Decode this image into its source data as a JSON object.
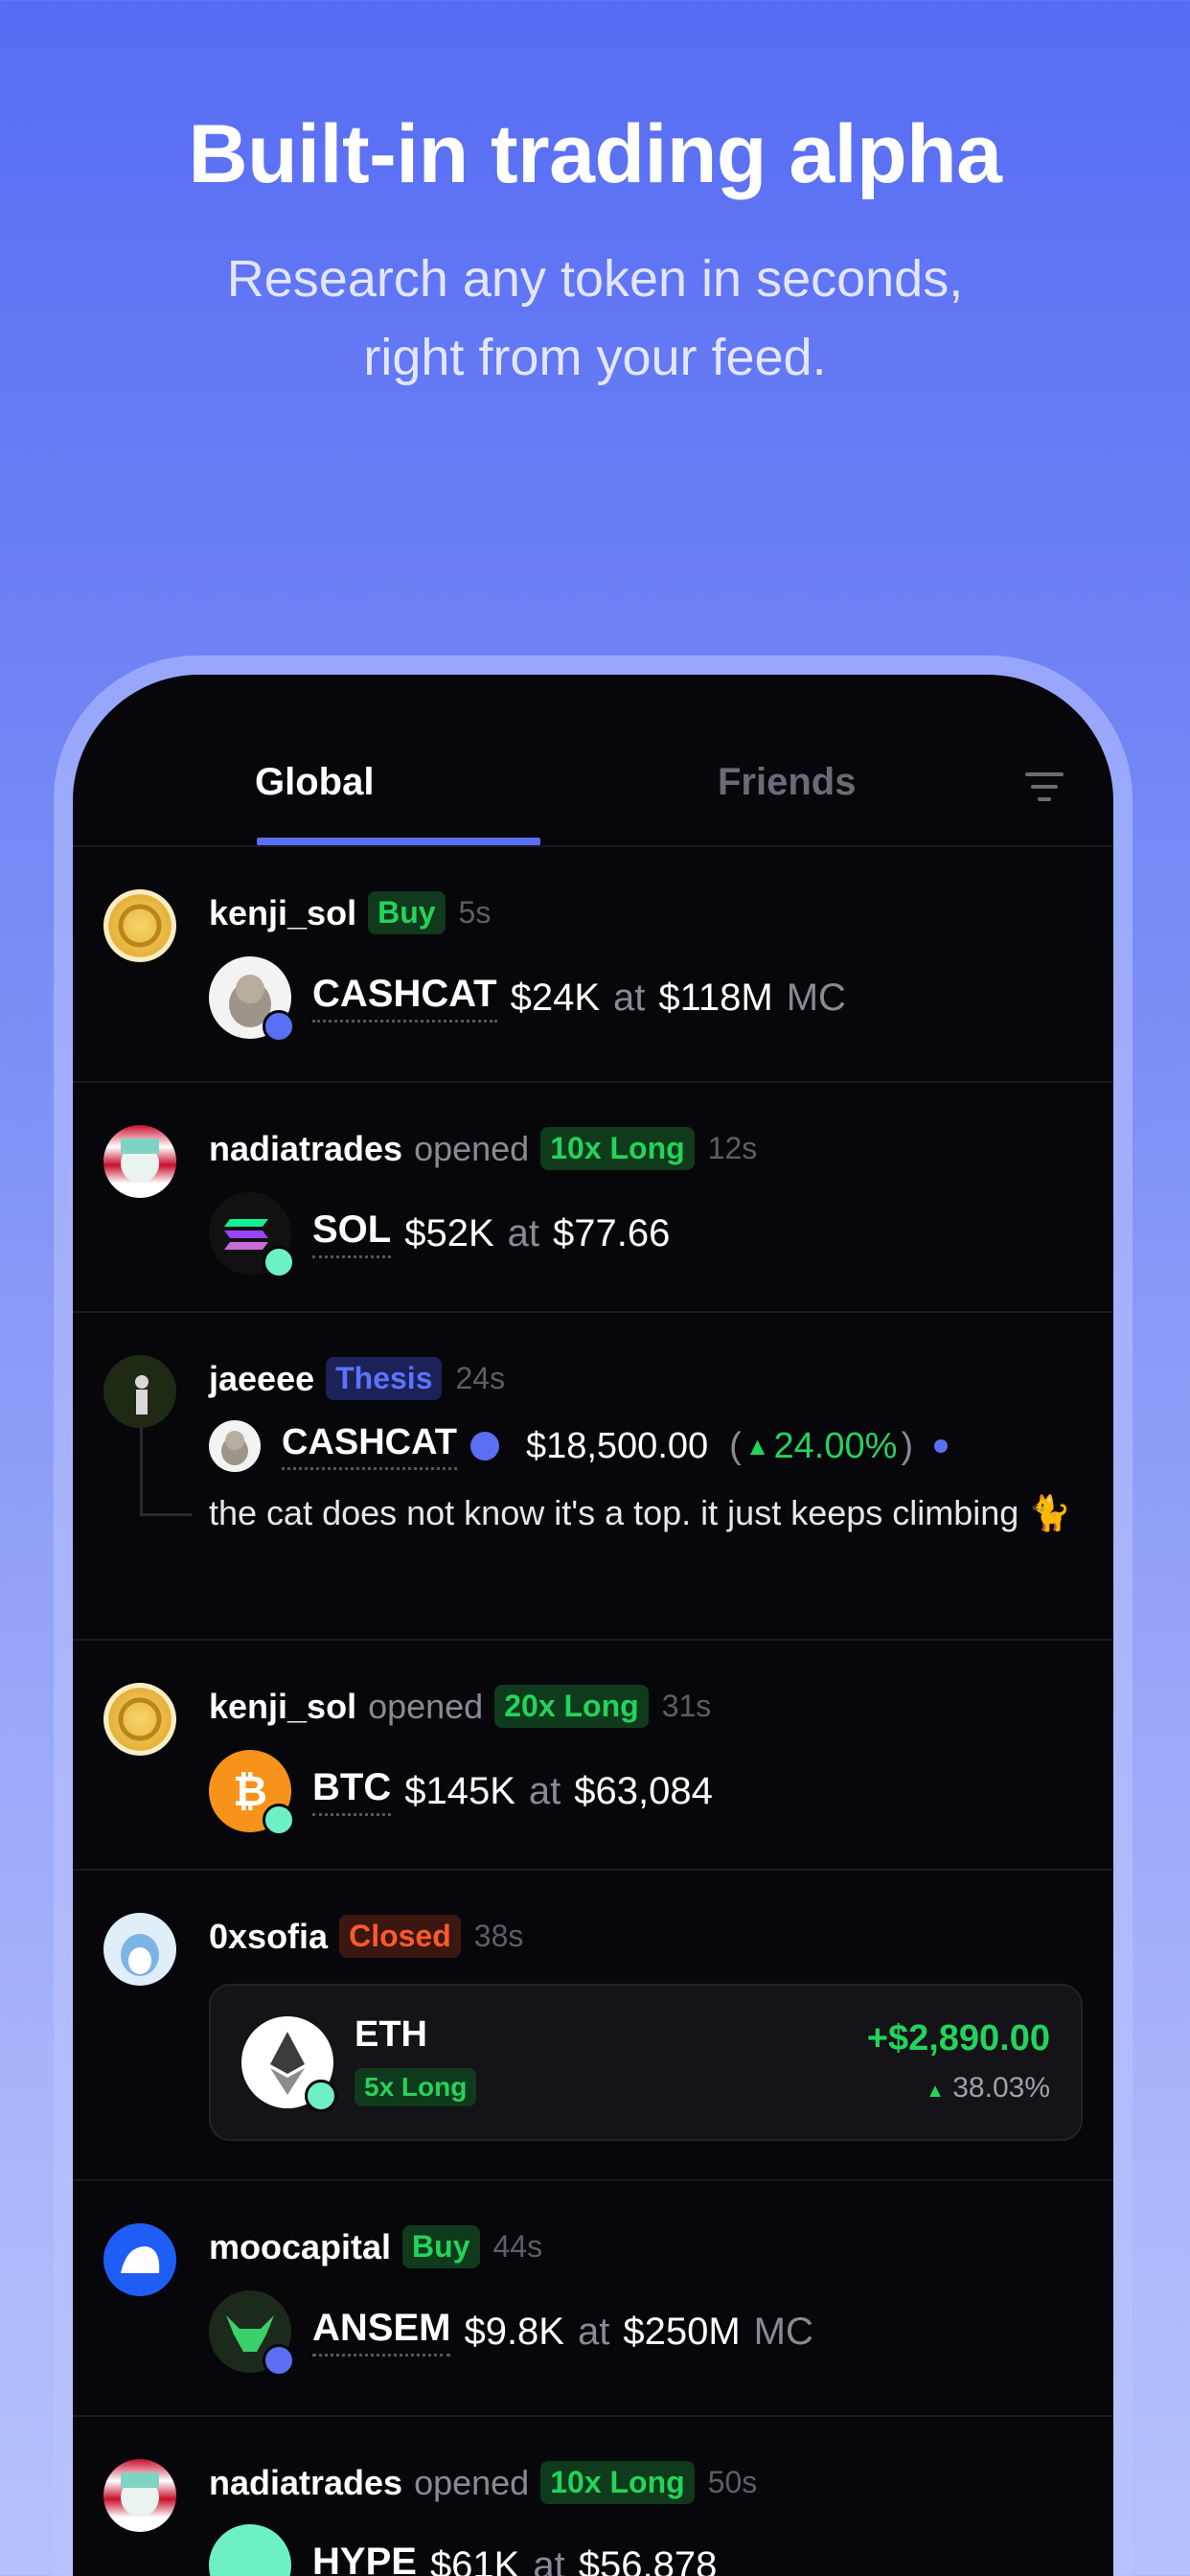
{
  "hero": {
    "title": "Built-in trading alpha",
    "subtitle_line1": "Research any token in seconds,",
    "subtitle_line2": "right from your feed."
  },
  "tabs": {
    "global": "Global",
    "friends": "Friends",
    "active": "Global"
  },
  "colors": {
    "accent": "#5a6ff2",
    "buy_green": "#24d35b",
    "closed_red": "#ff5a2b",
    "thesis_blue": "#5d73ff",
    "screen_bg": "#07070b"
  },
  "feed": [
    {
      "user": "kenji_sol",
      "verb": "",
      "badge": "Buy",
      "time": "5s",
      "ticker": "CASHCAT",
      "amount": "$24K",
      "at": "at",
      "price": "$118M",
      "suffix": "MC"
    },
    {
      "user": "nadiatrades",
      "verb": "opened",
      "badge": "10x Long",
      "time": "12s",
      "ticker": "SOL",
      "amount": "$52K",
      "at": "at",
      "price": "$77.66"
    },
    {
      "user": "jaeeee",
      "badge": "Thesis",
      "time": "24s",
      "ticker": "CASHCAT",
      "price": "$18,500.00",
      "change_open": "(",
      "change_arrow": "▲",
      "change": "24.00%",
      "change_close": ")",
      "text": "the cat does not know it's a top. it just keeps climbing 🐈"
    },
    {
      "user": "kenji_sol",
      "verb": "opened",
      "badge": "20x Long",
      "time": "31s",
      "ticker": "BTC",
      "amount": "$145K",
      "at": "at",
      "price": "$63,084"
    },
    {
      "user": "0xsofia",
      "badge": "Closed",
      "time": "38s",
      "ticker": "ETH",
      "position": "5x Long",
      "pnl": "+$2,890.00",
      "pnl_arrow": "▲",
      "pnl_pct": "38.03%"
    },
    {
      "user": "moocapital",
      "badge": "Buy",
      "time": "44s",
      "ticker": "ANSEM",
      "amount": "$9.8K",
      "at": "at",
      "price": "$250M",
      "suffix": "MC"
    },
    {
      "user": "nadiatrades",
      "verb": "opened",
      "badge": "10x Long",
      "time": "50s",
      "ticker": "HYPE",
      "amount": "$61K",
      "at": "at",
      "price": "$56,878"
    }
  ]
}
